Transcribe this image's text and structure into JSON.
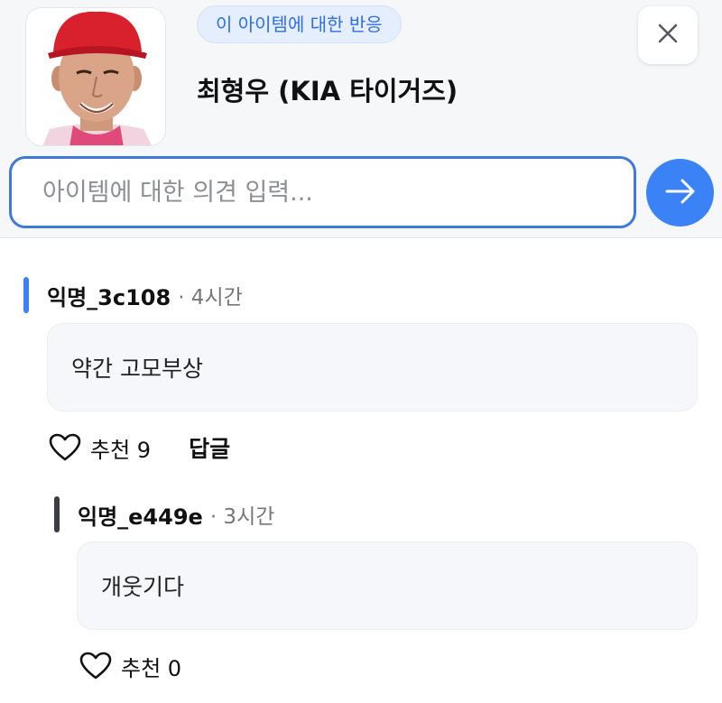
{
  "item": {
    "badge": "이 아이템에 대한 반응",
    "title": "최형우 (KIA 타이거즈)"
  },
  "input": {
    "placeholder": "아이템에 대한 의견 입력..."
  },
  "comments": [
    {
      "author": "익명_3c108",
      "time": "· 4시간",
      "text": "약간 고모부상",
      "like_label": "추천 9",
      "reply_label": "답글",
      "accent": "#3b82f6"
    },
    {
      "author": "익명_e449e",
      "time": "· 3시간",
      "text": "개웃기다",
      "like_label": "추천 0",
      "accent": "#3a3d44"
    }
  ]
}
